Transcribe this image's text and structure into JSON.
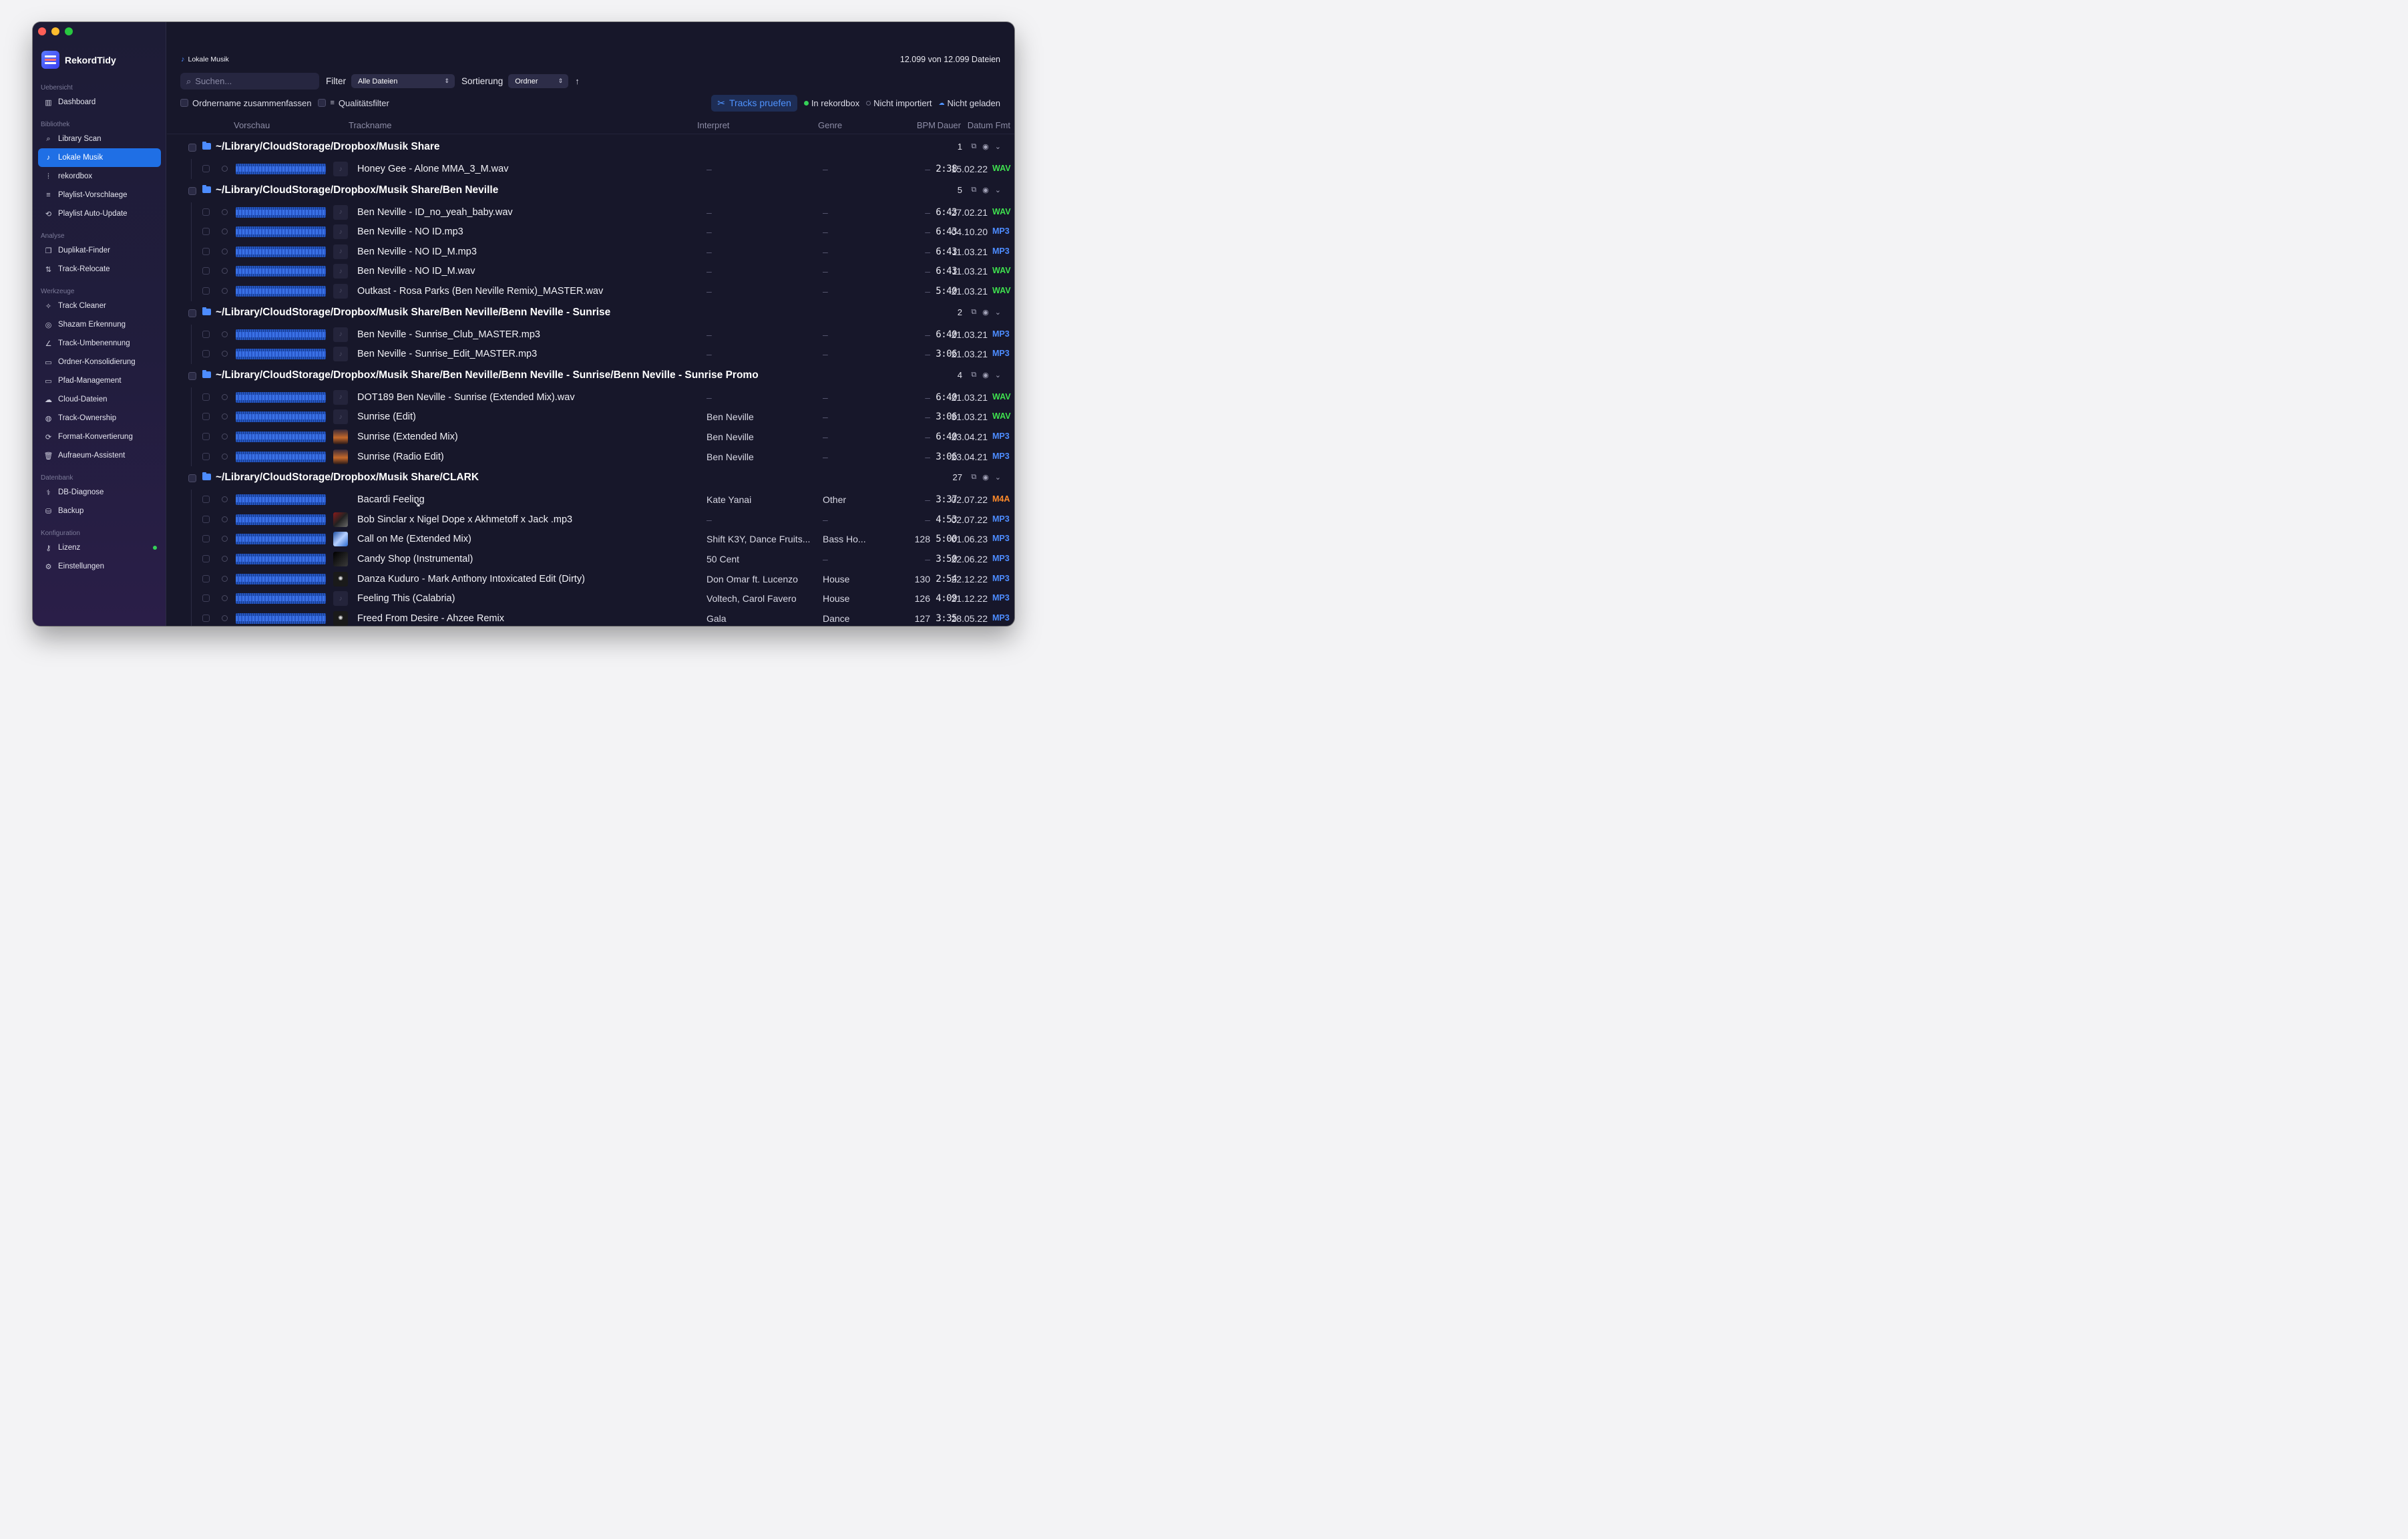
{
  "app": {
    "name": "RekordTidy"
  },
  "sidebar": {
    "sections": [
      {
        "title": "Uebersicht",
        "items": [
          {
            "label": "Dashboard",
            "icon": "chart-bar-icon"
          }
        ]
      },
      {
        "title": "Bibliothek",
        "items": [
          {
            "label": "Library Scan",
            "icon": "search-icon"
          },
          {
            "label": "Lokale Musik",
            "icon": "music-note-icon",
            "active": true
          },
          {
            "label": "rekordbox",
            "icon": "waveform-icon"
          },
          {
            "label": "Playlist-Vorschlaege",
            "icon": "playlist-icon"
          },
          {
            "label": "Playlist Auto-Update",
            "icon": "repeat-icon"
          }
        ]
      },
      {
        "title": "Analyse",
        "items": [
          {
            "label": "Duplikat-Finder",
            "icon": "copy-icon"
          },
          {
            "label": "Track-Relocate",
            "icon": "relocate-icon"
          }
        ]
      },
      {
        "title": "Werkzeuge",
        "items": [
          {
            "label": "Track Cleaner",
            "icon": "wand-icon"
          },
          {
            "label": "Shazam Erkennung",
            "icon": "shazam-icon"
          },
          {
            "label": "Track-Umbenennung",
            "icon": "pencil-icon"
          },
          {
            "label": "Ordner-Konsolidierung",
            "icon": "folder-merge-icon"
          },
          {
            "label": "Pfad-Management",
            "icon": "folder-path-icon"
          },
          {
            "label": "Cloud-Dateien",
            "icon": "cloud-icon"
          },
          {
            "label": "Track-Ownership",
            "icon": "ownership-icon"
          },
          {
            "label": "Format-Konvertierung",
            "icon": "convert-icon"
          },
          {
            "label": "Aufraeum-Assistent",
            "icon": "trash-icon"
          }
        ]
      },
      {
        "title": "Datenbank",
        "items": [
          {
            "label": "DB-Diagnose",
            "icon": "diagnose-icon"
          },
          {
            "label": "Backup",
            "icon": "backup-icon"
          }
        ]
      },
      {
        "title": "Konfiguration",
        "items": [
          {
            "label": "Lizenz",
            "icon": "key-icon",
            "status_dot": true
          },
          {
            "label": "Einstellungen",
            "icon": "gear-icon"
          }
        ]
      }
    ]
  },
  "header": {
    "breadcrumb": "Lokale Musik",
    "file_count": "12.099 von 12.099 Dateien"
  },
  "toolbar": {
    "search_placeholder": "Suchen...",
    "filter_label": "Filter",
    "filter_value": "Alle Dateien",
    "sort_label": "Sortierung",
    "sort_value": "Ordner",
    "group_folder_label": "Ordnername zusammenfassen",
    "quality_filter_label": "Qualitätsfilter",
    "check_tracks_label": "Tracks pruefen",
    "legend": {
      "in_rekordbox": "In rekordbox",
      "not_imported": "Nicht importiert",
      "not_loaded": "Nicht geladen"
    }
  },
  "columns": {
    "preview": "Vorschau",
    "trackname": "Trackname",
    "artist": "Interpret",
    "genre": "Genre",
    "bpm": "BPM",
    "duration": "Dauer",
    "date": "Datum",
    "format": "Fmt"
  },
  "format_colors": {
    "WAV": "#3fe04f",
    "MP3": "#4d8cff",
    "M4A": "#ff8a2a"
  },
  "groups": [
    {
      "path": "~/Library/CloudStorage/Dropbox/Musik Share",
      "count": "1",
      "tracks": [
        {
          "name": "Honey Gee - Alone MMA_3_M.wav",
          "artist": "–",
          "genre": "–",
          "bpm": "–",
          "duration": "2:38",
          "date": "15.02.22",
          "format": "WAV",
          "art": ""
        }
      ]
    },
    {
      "path": "~/Library/CloudStorage/Dropbox/Musik Share/Ben Neville",
      "count": "5",
      "tracks": [
        {
          "name": "Ben Neville - ID_no_yeah_baby.wav",
          "artist": "–",
          "genre": "–",
          "bpm": "–",
          "duration": "6:43",
          "date": "27.02.21",
          "format": "WAV",
          "art": ""
        },
        {
          "name": "Ben Neville - NO ID.mp3",
          "artist": "–",
          "genre": "–",
          "bpm": "–",
          "duration": "6:43",
          "date": "04.10.20",
          "format": "MP3",
          "art": ""
        },
        {
          "name": "Ben Neville - NO ID_M.mp3",
          "artist": "–",
          "genre": "–",
          "bpm": "–",
          "duration": "6:43",
          "date": "11.03.21",
          "format": "MP3",
          "art": ""
        },
        {
          "name": "Ben Neville - NO ID_M.wav",
          "artist": "–",
          "genre": "–",
          "bpm": "–",
          "duration": "6:43",
          "date": "11.03.21",
          "format": "WAV",
          "art": ""
        },
        {
          "name": "Outkast - Rosa Parks (Ben Neville Remix)_MASTER.wav",
          "artist": "–",
          "genre": "–",
          "bpm": "–",
          "duration": "5:40",
          "date": "21.03.21",
          "format": "WAV",
          "art": ""
        }
      ]
    },
    {
      "path": "~/Library/CloudStorage/Dropbox/Musik Share/Ben Neville/Benn Neville - Sunrise",
      "count": "2",
      "tracks": [
        {
          "name": "Ben Neville - Sunrise_Club_MASTER.mp3",
          "artist": "–",
          "genre": "–",
          "bpm": "–",
          "duration": "6:40",
          "date": "21.03.21",
          "format": "MP3",
          "art": ""
        },
        {
          "name": "Ben Neville - Sunrise_Edit_MASTER.mp3",
          "artist": "–",
          "genre": "–",
          "bpm": "–",
          "duration": "3:06",
          "date": "21.03.21",
          "format": "MP3",
          "art": ""
        }
      ]
    },
    {
      "path": "~/Library/CloudStorage/Dropbox/Musik Share/Ben Neville/Benn Neville - Sunrise/Benn Neville - Sunrise Promo",
      "count": "4",
      "tracks": [
        {
          "name": "DOT189 Ben Neville - Sunrise (Extended Mix).wav",
          "artist": "–",
          "genre": "–",
          "bpm": "–",
          "duration": "6:40",
          "date": "21.03.21",
          "format": "WAV",
          "art": ""
        },
        {
          "name": "Sunrise (Edit)",
          "artist": "Ben Neville",
          "genre": "–",
          "bpm": "–",
          "duration": "3:06",
          "date": "31.03.21",
          "format": "WAV",
          "art": ""
        },
        {
          "name": "Sunrise (Extended Mix)",
          "artist": "Ben Neville",
          "genre": "–",
          "bpm": "–",
          "duration": "6:40",
          "date": "23.04.21",
          "format": "MP3",
          "art": "img1"
        },
        {
          "name": "Sunrise (Radio Edit)",
          "artist": "Ben Neville",
          "genre": "–",
          "bpm": "–",
          "duration": "3:06",
          "date": "23.04.21",
          "format": "MP3",
          "art": "img1"
        }
      ]
    },
    {
      "path": "~/Library/CloudStorage/Dropbox/Musik Share/CLARK",
      "count": "27",
      "tracks": [
        {
          "name": "Bacardi Feeling",
          "artist": "Kate Yanai",
          "genre": "Other",
          "bpm": "–",
          "duration": "3:37",
          "date": "02.07.22",
          "format": "M4A",
          "art": "none"
        },
        {
          "name": "Bob Sinclar x Nigel Dope x Akhmetoff x Jack .mp3",
          "artist": "–",
          "genre": "–",
          "bpm": "–",
          "duration": "4:53",
          "date": "02.07.22",
          "format": "MP3",
          "art": "img2"
        },
        {
          "name": "Call on Me (Extended Mix)",
          "artist": "Shift K3Y, Dance Fruits...",
          "genre": "Bass Ho...",
          "bpm": "128",
          "duration": "5:00",
          "date": "01.06.23",
          "format": "MP3",
          "art": "img3"
        },
        {
          "name": "Candy Shop (Instrumental)",
          "artist": "50 Cent",
          "genre": "–",
          "bpm": "–",
          "duration": "3:50",
          "date": "22.06.22",
          "format": "MP3",
          "art": "img4"
        },
        {
          "name": "Danza Kuduro - Mark Anthony Intoxicated Edit (Dirty)",
          "artist": "Don Omar ft. Lucenzo",
          "genre": "House",
          "bpm": "130",
          "duration": "2:54",
          "date": "22.12.22",
          "format": "MP3",
          "art": "img5"
        },
        {
          "name": "Feeling This (Calabria)",
          "artist": "Voltech, Carol Favero",
          "genre": "House",
          "bpm": "126",
          "duration": "4:09",
          "date": "21.12.22",
          "format": "MP3",
          "art": ""
        },
        {
          "name": "Freed From Desire - Ahzee Remix",
          "artist": "Gala",
          "genre": "Dance",
          "bpm": "127",
          "duration": "3:35",
          "date": "28.05.22",
          "format": "MP3",
          "art": "img5"
        }
      ]
    }
  ]
}
